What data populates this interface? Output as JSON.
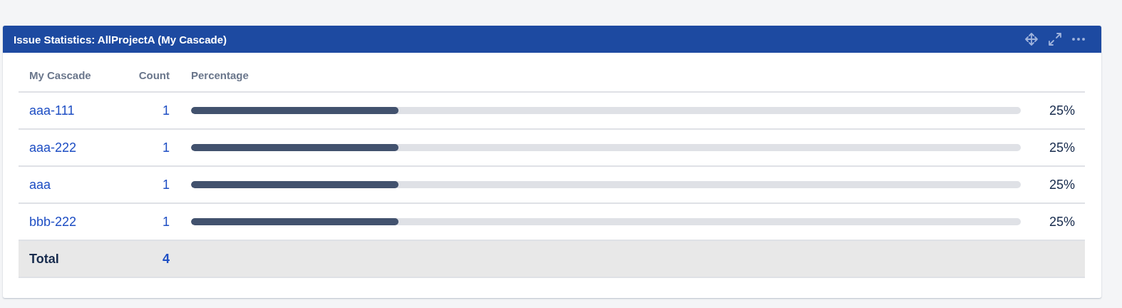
{
  "gadget": {
    "title": "Issue Statistics: AllProjectA (My Cascade)"
  },
  "table": {
    "columns": [
      "My Cascade",
      "Count",
      "Percentage"
    ],
    "rows": [
      {
        "name": "aaa-111",
        "count": "1",
        "level": 0.25,
        "percent": "25%"
      },
      {
        "name": "aaa-222",
        "count": "1",
        "level": 0.25,
        "percent": "25%"
      },
      {
        "name": "aaa",
        "count": "1",
        "level": 0.25,
        "percent": "25%"
      },
      {
        "name": "bbb-222",
        "count": "1",
        "level": 0.25,
        "percent": "25%"
      }
    ],
    "total": {
      "label": "Total",
      "count": "4"
    }
  }
}
